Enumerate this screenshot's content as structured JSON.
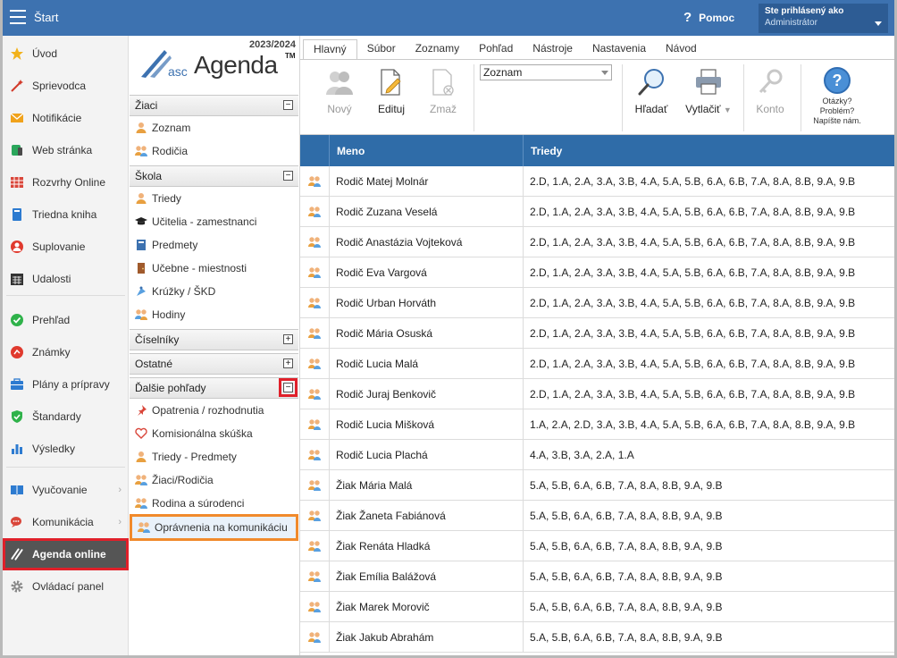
{
  "topbar": {
    "title": "Štart",
    "help": "Pomoc",
    "user_line1": "Ste prihlásený ako",
    "user_line2": "Administrátor"
  },
  "leftnav": {
    "items": [
      {
        "label": "Úvod",
        "icon": "star-icon"
      },
      {
        "label": "Sprievodca",
        "icon": "wand-icon"
      },
      {
        "label": "Notifikácie",
        "icon": "envelope-icon"
      },
      {
        "label": "Web stránka",
        "icon": "web-icon"
      },
      {
        "label": "Rozvrhy Online",
        "icon": "timetable-icon"
      },
      {
        "label": "Triedna kniha",
        "icon": "book-icon"
      },
      {
        "label": "Suplovanie",
        "icon": "person-icon"
      },
      {
        "label": "Udalosti",
        "icon": "calendar-icon"
      },
      {
        "label": "Prehľad",
        "icon": "check-circle-icon"
      },
      {
        "label": "Známky",
        "icon": "grade-icon"
      },
      {
        "label": "Plány a prípravy",
        "icon": "briefcase-icon"
      },
      {
        "label": "Štandardy",
        "icon": "shield-icon"
      },
      {
        "label": "Výsledky",
        "icon": "bar-chart-icon"
      },
      {
        "label": "Vyučovanie",
        "icon": "open-book-icon"
      },
      {
        "label": "Komunikácia",
        "icon": "chat-icon"
      },
      {
        "label": "Agenda online",
        "icon": "agenda-icon"
      },
      {
        "label": "Ovládací panel",
        "icon": "gear-icon"
      }
    ]
  },
  "agenda": {
    "year": "2023/2024",
    "logo_asc": "asc",
    "logo_agenda": "Agenda",
    "logo_tm": "TM",
    "sections": {
      "ziaci": {
        "label": "Žiaci",
        "toggle": "−"
      },
      "skola": {
        "label": "Škola",
        "toggle": "−"
      },
      "ciselniky": {
        "label": "Číselníky",
        "toggle": "+"
      },
      "ostatne": {
        "label": "Ostatné",
        "toggle": "+"
      },
      "dalsie": {
        "label": "Ďalšie pohľady",
        "toggle": "−"
      }
    },
    "ziaci_items": [
      {
        "label": "Zoznam"
      },
      {
        "label": "Rodičia"
      }
    ],
    "skola_items": [
      {
        "label": "Triedy"
      },
      {
        "label": "Učitelia - zamestnanci"
      },
      {
        "label": "Predmety"
      },
      {
        "label": "Učebne - miestnosti"
      },
      {
        "label": "Krúžky / ŠKD"
      },
      {
        "label": "Hodiny"
      }
    ],
    "dalsie_items": [
      {
        "label": "Opatrenia / rozhodnutia"
      },
      {
        "label": "Komisionálna skúška"
      },
      {
        "label": "Triedy - Predmety"
      },
      {
        "label": "Žiaci/Rodičia"
      },
      {
        "label": "Rodina a súrodenci"
      },
      {
        "label": "Oprávnenia na komunikáciu"
      }
    ]
  },
  "tabs": [
    {
      "label": "Hlavný",
      "active": true
    },
    {
      "label": "Súbor"
    },
    {
      "label": "Zoznamy"
    },
    {
      "label": "Pohľad"
    },
    {
      "label": "Nástroje"
    },
    {
      "label": "Nastavenia"
    },
    {
      "label": "Návod"
    }
  ],
  "ribbon": {
    "new": "Nový",
    "edit": "Edituj",
    "delete": "Zmaž",
    "select_value": "Zoznam",
    "search": "Hľadať",
    "print": "Vytlačiť",
    "account": "Konto",
    "help_line1": "Otázky?",
    "help_line2": "Problém?",
    "help_line3": "Napíšte nám."
  },
  "table": {
    "headers": {
      "name": "Meno",
      "classes": "Triedy"
    },
    "rows": [
      {
        "name": "Rodič Matej Molnár",
        "classes": "2.D, 1.A, 2.A, 3.A, 3.B, 4.A, 5.A, 5.B, 6.A, 6.B, 7.A, 8.A, 8.B, 9.A, 9.B"
      },
      {
        "name": "Rodič Zuzana Veselá",
        "classes": "2.D, 1.A, 2.A, 3.A, 3.B, 4.A, 5.A, 5.B, 6.A, 6.B, 7.A, 8.A, 8.B, 9.A, 9.B"
      },
      {
        "name": "Rodič Anastázia Vojteková",
        "classes": "2.D, 1.A, 2.A, 3.A, 3.B, 4.A, 5.A, 5.B, 6.A, 6.B, 7.A, 8.A, 8.B, 9.A, 9.B"
      },
      {
        "name": "Rodič Eva Vargová",
        "classes": "2.D, 1.A, 2.A, 3.A, 3.B, 4.A, 5.A, 5.B, 6.A, 6.B, 7.A, 8.A, 8.B, 9.A, 9.B"
      },
      {
        "name": "Rodič Urban Horváth",
        "classes": "2.D, 1.A, 2.A, 3.A, 3.B, 4.A, 5.A, 5.B, 6.A, 6.B, 7.A, 8.A, 8.B, 9.A, 9.B"
      },
      {
        "name": "Rodič Mária Osuská",
        "classes": "2.D, 1.A, 2.A, 3.A, 3.B, 4.A, 5.A, 5.B, 6.A, 6.B, 7.A, 8.A, 8.B, 9.A, 9.B"
      },
      {
        "name": "Rodič Lucia Malá",
        "classes": "2.D, 1.A, 2.A, 3.A, 3.B, 4.A, 5.A, 5.B, 6.A, 6.B, 7.A, 8.A, 8.B, 9.A, 9.B"
      },
      {
        "name": "Rodič Juraj Benkovič",
        "classes": "2.D, 1.A, 2.A, 3.A, 3.B, 4.A, 5.A, 5.B, 6.A, 6.B, 7.A, 8.A, 8.B, 9.A, 9.B"
      },
      {
        "name": "Rodič Lucia Mišková",
        "classes": "1.A, 2.A, 2.D, 3.A, 3.B, 4.A, 5.A, 5.B, 6.A, 6.B, 7.A, 8.A, 8.B, 9.A, 9.B"
      },
      {
        "name": "Rodič Lucia Plachá",
        "classes": "4.A, 3.B, 3.A, 2.A, 1.A"
      },
      {
        "name": "Žiak Mária Malá",
        "classes": "5.A, 5.B, 6.A, 6.B, 7.A, 8.A, 8.B, 9.A, 9.B"
      },
      {
        "name": "Žiak Žaneta Fabiánová",
        "classes": "5.A, 5.B, 6.A, 6.B, 7.A, 8.A, 8.B, 9.A, 9.B"
      },
      {
        "name": "Žiak Renáta Hladká",
        "classes": "5.A, 5.B, 6.A, 6.B, 7.A, 8.A, 8.B, 9.A, 9.B"
      },
      {
        "name": "Žiak Emília Balážová",
        "classes": "5.A, 5.B, 6.A, 6.B, 7.A, 8.A, 8.B, 9.A, 9.B"
      },
      {
        "name": "Žiak Marek Morovič",
        "classes": "5.A, 5.B, 6.A, 6.B, 7.A, 8.A, 8.B, 9.A, 9.B"
      },
      {
        "name": "Žiak Jakub Abrahám",
        "classes": "5.A, 5.B, 6.A, 6.B, 7.A, 8.A, 8.B, 9.A, 9.B"
      }
    ]
  },
  "colors": {
    "topbar": "#3d72b0",
    "table_header": "#2f6ca8",
    "highlight_red": "#e0202a",
    "highlight_orange": "#f18a2c"
  }
}
